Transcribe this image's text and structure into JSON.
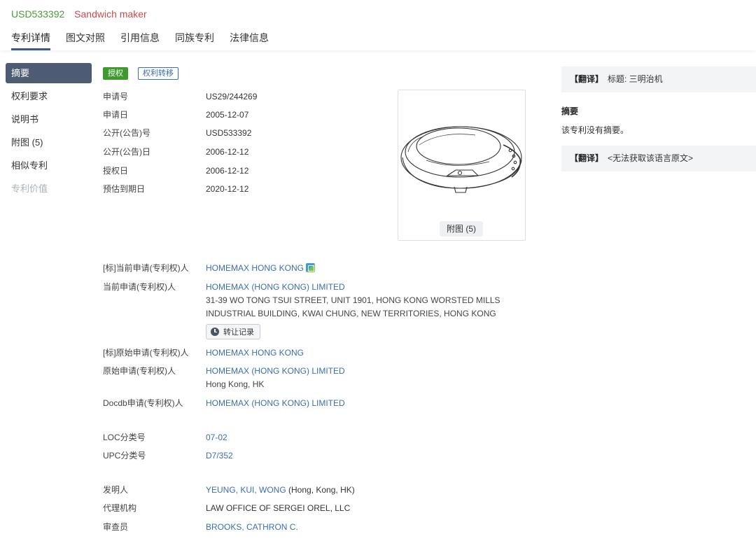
{
  "header": {
    "patent_id": "USD533392",
    "patent_title": "Sandwich maker",
    "tabs": [
      "专利详情",
      "图文对照",
      "引用信息",
      "同族专利",
      "法律信息"
    ]
  },
  "sidebar": {
    "items": [
      "摘要",
      "权利要求",
      "说明书",
      "附图 (5)",
      "相似专利",
      "专利价值"
    ]
  },
  "tags": {
    "granted": "授权",
    "transfer": "权利转移"
  },
  "fields": {
    "app_no": {
      "label": "申请号",
      "value": "US29/244269"
    },
    "app_date": {
      "label": "申请日",
      "value": "2005-12-07"
    },
    "pub_no": {
      "label": "公开(公告)号",
      "value": "USD533392"
    },
    "pub_date": {
      "label": "公开(公告)日",
      "value": "2006-12-12"
    },
    "grant_date": {
      "label": "授权日",
      "value": "2006-12-12"
    },
    "expiry_date": {
      "label": "预估到期日",
      "value": "2020-12-12"
    },
    "std_current_applicant": {
      "label": "[标]当前申请(专利权)人",
      "value": "HOMEMAX HONG KONG"
    },
    "current_applicant": {
      "label": "当前申请(专利权)人",
      "value": "HOMEMAX (HONG KONG) LIMITED",
      "address1": "31-39 WO TONG TSUI STREET, UNIT 1901, HONG KONG WORSTED MILLS",
      "address2": "INDUSTRIAL BUILDING, KWAI CHUNG, NEW TERRITORIES, HONG KONG",
      "history_button": "转让记录"
    },
    "std_original_applicant": {
      "label": "[标]原始申请(专利权)人",
      "value": "HOMEMAX HONG KONG"
    },
    "original_applicant": {
      "label": "原始申请(专利权)人",
      "value": "HOMEMAX (HONG KONG) LIMITED",
      "location": "Hong Kong, HK"
    },
    "docdb_applicant": {
      "label": "Docdb申请(专利权)人",
      "value": "HOMEMAX (HONG KONG) LIMITED"
    },
    "loc": {
      "label": "LOC分类号",
      "value": "07-02"
    },
    "upc": {
      "label": "UPC分类号",
      "value": "D7/352"
    },
    "inventor": {
      "label": "发明人",
      "value": "YEUNG, KUI, WONG",
      "location": " (Hong, Kong, HK)"
    },
    "agency": {
      "label": "代理机构",
      "value": "LAW OFFICE OF SERGEI OREL, LLC"
    },
    "examiner": {
      "label": "审查员",
      "value": "BROOKS, CATHRON C."
    }
  },
  "figure": {
    "button": "附图 (5)"
  },
  "right_panel": {
    "translate_tag": "【翻译】",
    "title_translation": "标题: 三明治机",
    "abstract_heading": "摘要",
    "abstract_text": "该专利没有摘要。",
    "original_unavailable": "<无法获取该语言原文>"
  },
  "colors": {
    "accent": "#3b5b8f",
    "link": "#3a6fb0",
    "granted": "#3e9a2c",
    "id_green": "#4a9a3a",
    "title_red": "#c94a4a"
  }
}
